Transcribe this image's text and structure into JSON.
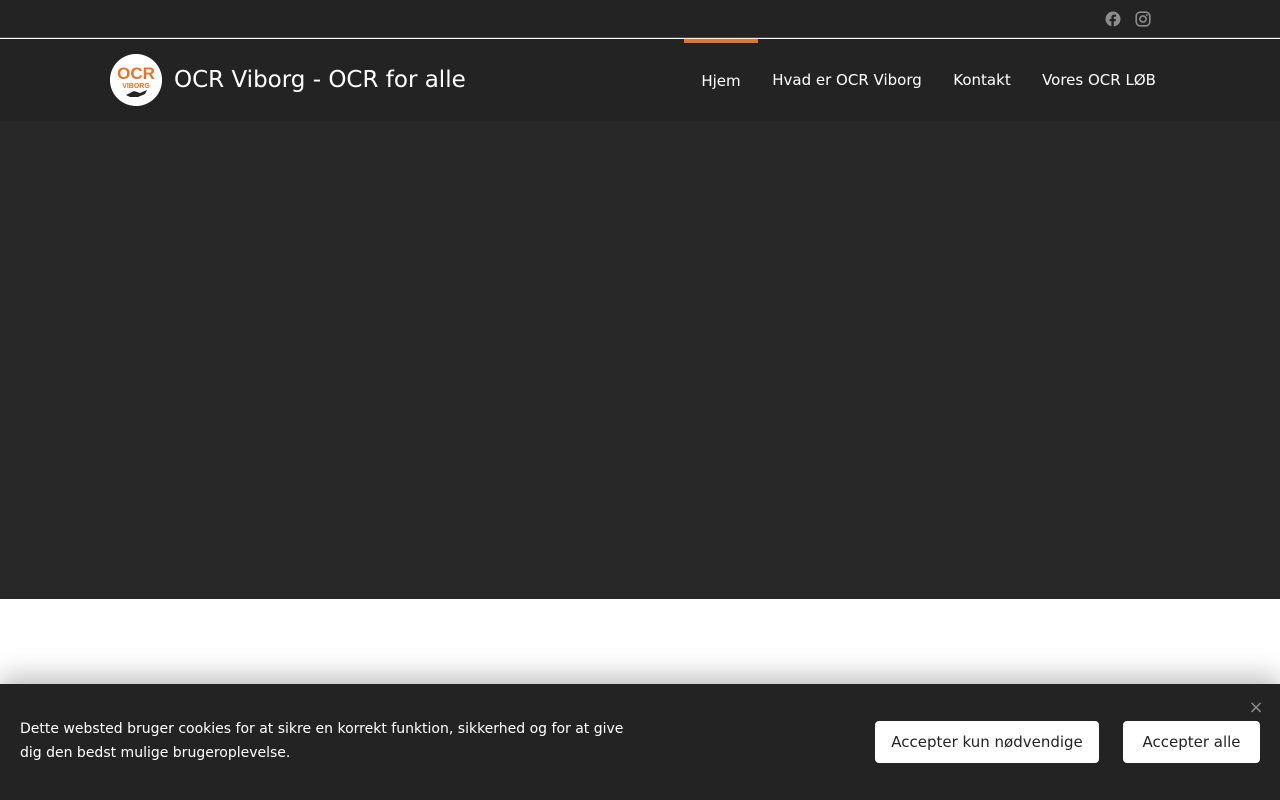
{
  "site": {
    "title": "OCR Viborg - OCR for alle",
    "logo": {
      "line1": "OCR",
      "line2": "VIBORG"
    }
  },
  "social": [
    {
      "icon": "facebook-icon"
    },
    {
      "icon": "instagram-icon"
    }
  ],
  "nav": {
    "items": [
      {
        "label": "Hjem",
        "active": true
      },
      {
        "label": "Hvad er OCR Viborg",
        "active": false
      },
      {
        "label": "Kontakt",
        "active": false
      },
      {
        "label": "Vores OCR LØB",
        "active": false
      }
    ]
  },
  "cookie": {
    "text": "Dette websted bruger cookies for at sikre en korrekt funktion, sikkerhed og for at give dig den bedst mulige brugeroplevelse.",
    "necessary_label": "Accepter kun nødvendige",
    "accept_all_label": "Accepter alle",
    "close_symbol": "×"
  },
  "colors": {
    "accent": "#e8722a",
    "dark": "#232323",
    "hero": "#282828"
  }
}
